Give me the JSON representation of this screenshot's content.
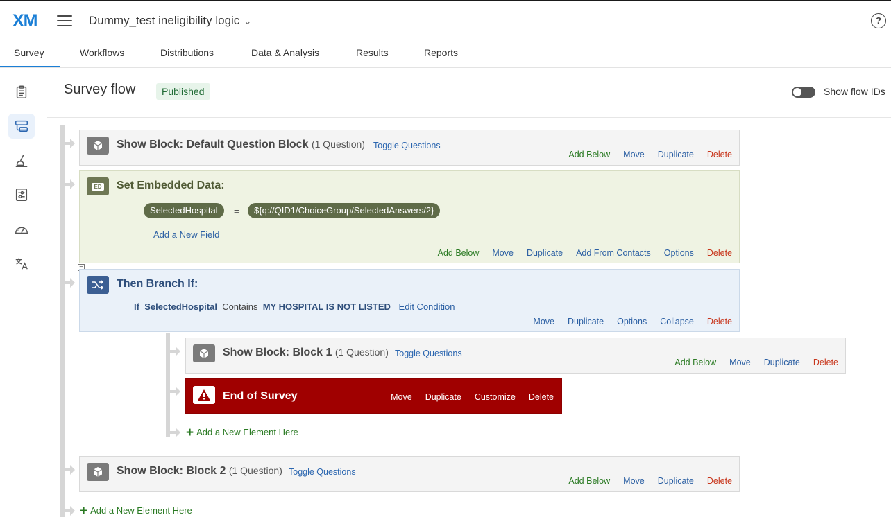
{
  "app": {
    "logo": "XM",
    "project_title": "Dummy_test ineligibility logic",
    "help_label": "?"
  },
  "tabs": [
    {
      "label": "Survey"
    },
    {
      "label": "Workflows"
    },
    {
      "label": "Distributions"
    },
    {
      "label": "Data & Analysis"
    },
    {
      "label": "Results"
    },
    {
      "label": "Reports"
    }
  ],
  "page": {
    "title": "Survey flow",
    "status": "Published",
    "flow_ids_label": "Show flow IDs"
  },
  "flow": {
    "block1": {
      "title": "Show Block: Default Question Block",
      "count": "(1 Question)",
      "toggle": "Toggle Questions",
      "actions": {
        "add_below": "Add Below",
        "move": "Move",
        "duplicate": "Duplicate",
        "delete": "Delete"
      }
    },
    "embedded": {
      "icon_text": "ED",
      "title": "Set Embedded Data:",
      "field_name": "SelectedHospital",
      "equals": "=",
      "field_value": "${q://QID1/ChoiceGroup/SelectedAnswers/2}",
      "add_field": "Add a New Field",
      "actions": {
        "add_below": "Add Below",
        "move": "Move",
        "duplicate": "Duplicate",
        "add_from_contacts": "Add From Contacts",
        "options": "Options",
        "delete": "Delete"
      }
    },
    "branch": {
      "title": "Then Branch If:",
      "cond_if": "If",
      "cond_field": "SelectedHospital",
      "cond_op": "Contains",
      "cond_value": "MY HOSPITAL IS NOT LISTED",
      "edit": "Edit Condition",
      "collapse_marker": "−",
      "actions": {
        "move": "Move",
        "duplicate": "Duplicate",
        "options": "Options",
        "collapse": "Collapse",
        "delete": "Delete"
      }
    },
    "block_inner": {
      "title": "Show Block: Block 1",
      "count": "(1 Question)",
      "toggle": "Toggle Questions",
      "actions": {
        "add_below": "Add Below",
        "move": "Move",
        "duplicate": "Duplicate",
        "delete": "Delete"
      }
    },
    "end": {
      "title": "End of Survey",
      "actions": {
        "move": "Move",
        "duplicate": "Duplicate",
        "customize": "Customize",
        "delete": "Delete"
      }
    },
    "add_inner": "Add a New Element Here",
    "block2": {
      "title": "Show Block: Block 2",
      "count": "(1 Question)",
      "toggle": "Toggle Questions",
      "actions": {
        "add_below": "Add Below",
        "move": "Move",
        "duplicate": "Duplicate",
        "delete": "Delete"
      }
    },
    "add_outer": "Add a New Element Here"
  }
}
